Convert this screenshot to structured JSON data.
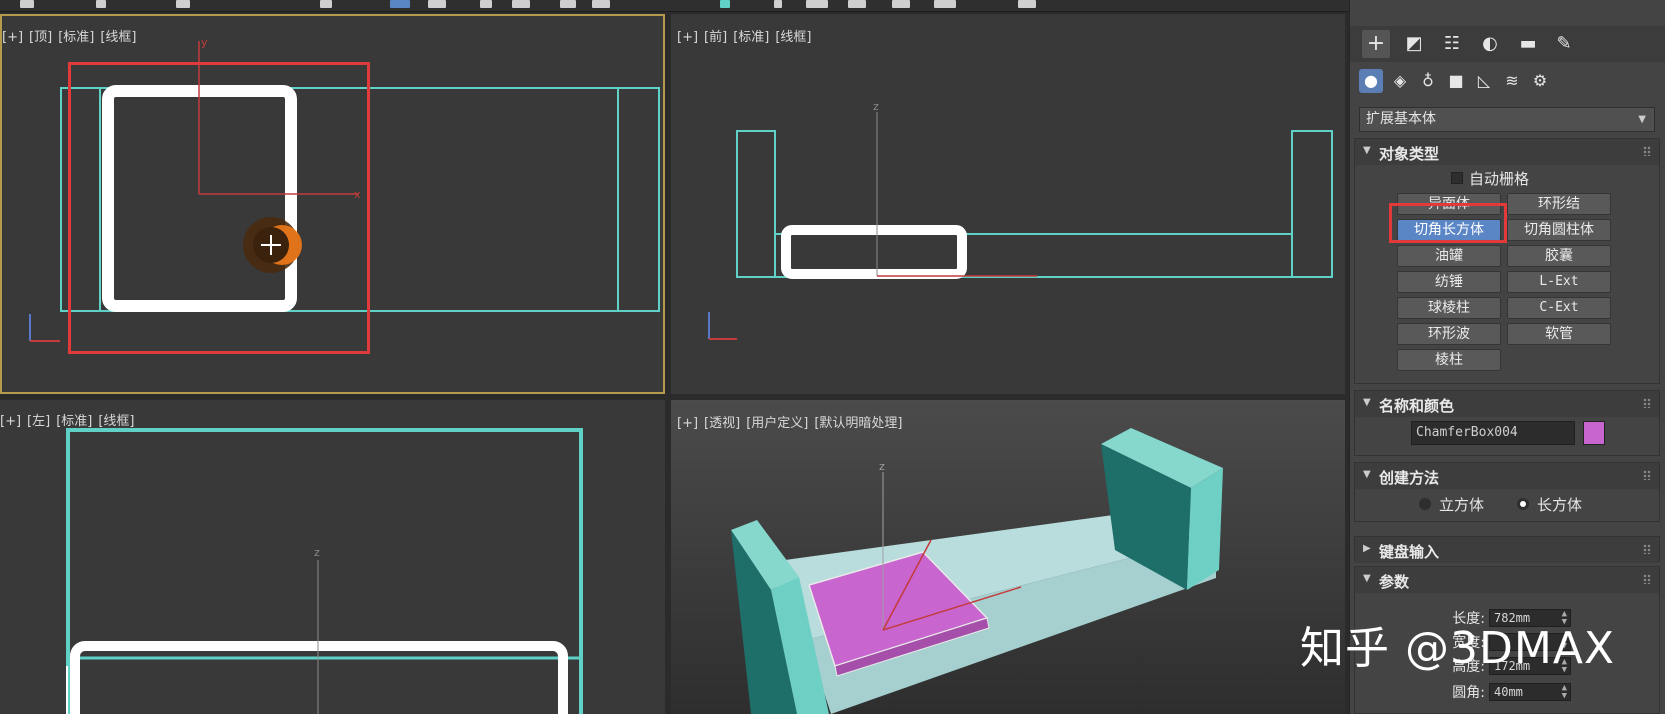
{
  "viewports": {
    "top": {
      "labels": [
        "[+]",
        "[顶]",
        "[标准]",
        "[线框]"
      ]
    },
    "front": {
      "labels": [
        "[+]",
        "[前]",
        "[标准]",
        "[线框]"
      ]
    },
    "left": {
      "labels": [
        "[+]",
        "[左]",
        "[标准]",
        "[线框]"
      ]
    },
    "persp": {
      "labels": [
        "[+]",
        "[透视]",
        "[用户定义]",
        "[默认明暗处理]"
      ]
    },
    "axis": {
      "x": "x",
      "y": "y",
      "z": "z"
    }
  },
  "command_panel": {
    "tabs": [
      "create-tab",
      "modify-tab",
      "hierarchy-tab",
      "motion-tab",
      "display-tab",
      "utilities-tab"
    ],
    "subcategories": [
      "geometry",
      "shapes",
      "lights",
      "cameras",
      "helpers",
      "space-warps",
      "systems"
    ],
    "dropdown_value": "扩展基本体",
    "object_type": {
      "title": "对象类型",
      "autogrid_label": "自动栅格",
      "buttons": [
        "异面体",
        "环形结",
        "切角长方体",
        "切角圆柱体",
        "油罐",
        "胶囊",
        "纺锤",
        "L-Ext",
        "球棱柱",
        "C-Ext",
        "环形波",
        "软管",
        "棱柱"
      ],
      "selected": "切角长方体"
    },
    "name_color": {
      "title": "名称和颜色",
      "name_value": "ChamferBox004",
      "color": "#c865cf"
    },
    "creation_method": {
      "title": "创建方法",
      "options": [
        "立方体",
        "长方体"
      ],
      "selected": "长方体"
    },
    "keyboard_entry": {
      "title": "键盘输入"
    },
    "parameters": {
      "title": "参数",
      "fields": [
        {
          "label": "长度:",
          "value": "782mm"
        },
        {
          "label": "宽度:",
          "value": ""
        },
        {
          "label": "高度:",
          "value": "172mm"
        },
        {
          "label": "圆角:",
          "value": "40mm"
        }
      ]
    }
  },
  "watermark": "知乎 @3DMAX",
  "colors": {
    "wire_cyan": "#5fd1c6",
    "wire_white": "#ffffff",
    "highlight_red": "#e03a3a",
    "accent_blue": "#5b86c6",
    "viewport_active": "#b79b4d"
  }
}
